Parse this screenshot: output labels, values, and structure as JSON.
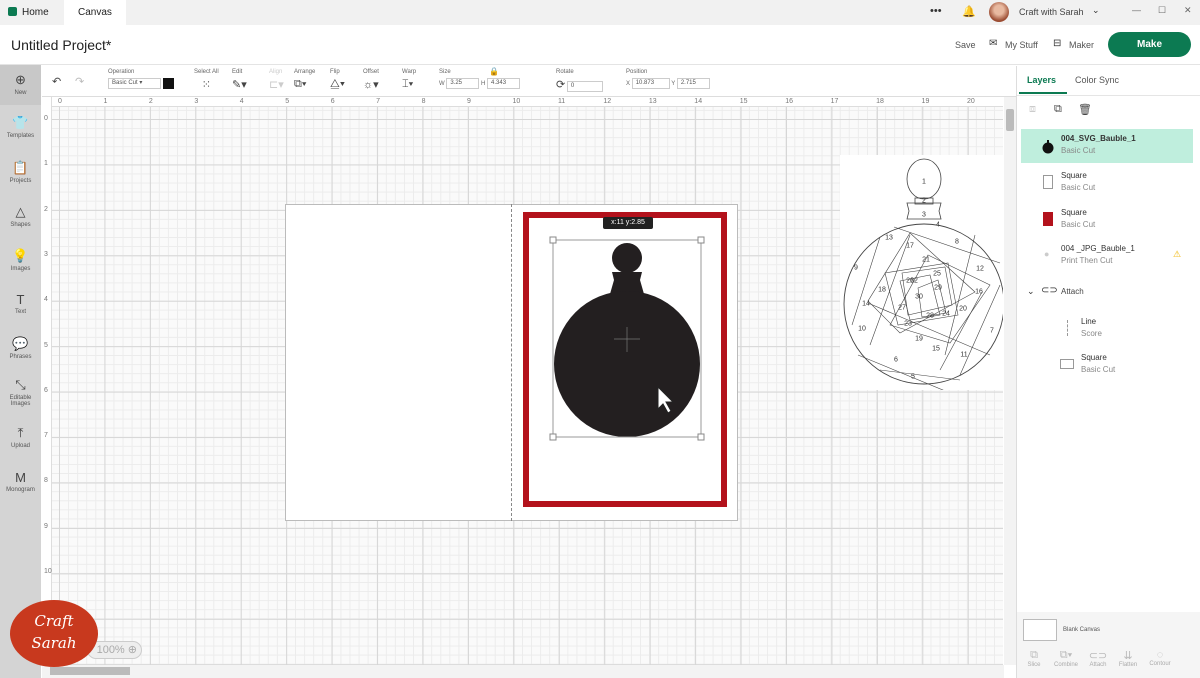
{
  "tabs": [
    {
      "label": "Home"
    },
    {
      "label": "Canvas"
    }
  ],
  "window": {
    "user": "Craft with Sarah",
    "more": "•••",
    "minimize": "—",
    "maximize": "☐",
    "close": "✕"
  },
  "header": {
    "project_title": "Untitled Project*",
    "save": "Save",
    "my_stuff": "My Stuff",
    "maker": "Maker",
    "make": "Make"
  },
  "toolbar": {
    "operation_label": "Operation",
    "operation_value": "Basic Cut",
    "select_all": "Select All",
    "edit": "Edit",
    "align": "Align",
    "arrange": "Arrange",
    "flip": "Flip",
    "offset": "Offset",
    "warp": "Warp",
    "size": "Size",
    "w_label": "W",
    "w_value": "3.25",
    "h_label": "H",
    "h_value": "4.343",
    "rotate": "Rotate",
    "rotate_value": "0",
    "position": "Position",
    "x_label": "X",
    "x_value": "10.873",
    "y_label": "Y",
    "y_value": "2.715",
    "color": "#111111"
  },
  "sidebar": [
    {
      "label": "New",
      "icon": "⊕"
    },
    {
      "label": "Templates",
      "icon": "👕"
    },
    {
      "label": "Projects",
      "icon": "📋"
    },
    {
      "label": "Shapes",
      "icon": "△"
    },
    {
      "label": "Images",
      "icon": "💡"
    },
    {
      "label": "Text",
      "icon": "T"
    },
    {
      "label": "Phrases",
      "icon": "💬"
    },
    {
      "label": "Editable Images",
      "icon": "⤡"
    },
    {
      "label": "Upload",
      "icon": "⤒"
    },
    {
      "label": "Monogram",
      "icon": "M"
    }
  ],
  "ruler": {
    "h": [
      "0",
      "1",
      "2",
      "3",
      "4",
      "5",
      "6",
      "7",
      "8",
      "9",
      "10",
      "11",
      "12",
      "13",
      "14",
      "15",
      "16",
      "17",
      "18",
      "19",
      "20"
    ],
    "v": [
      "0",
      "1",
      "2",
      "3",
      "4",
      "5",
      "6",
      "7",
      "8",
      "9",
      "10"
    ]
  },
  "canvas": {
    "tooltip": "x:11 y:2.85",
    "zoom": "100%",
    "colors": {
      "red": "#b3121c",
      "bauble": "#231f20"
    }
  },
  "pattern_numbers": [
    "1",
    "2",
    "3",
    "4",
    "5",
    "6",
    "7",
    "8",
    "9",
    "10",
    "11",
    "12",
    "13",
    "14",
    "15",
    "16",
    "17",
    "18",
    "19",
    "20",
    "21",
    "22",
    "23",
    "24",
    "25",
    "26",
    "27",
    "28",
    "29",
    "30"
  ],
  "panel": {
    "tabs": [
      "Layers",
      "Color Sync"
    ],
    "layers": [
      {
        "name": "004_SVG_Bauble_1",
        "sub": "Basic Cut"
      },
      {
        "name": "Square",
        "sub": "Basic Cut"
      },
      {
        "name": "Square",
        "sub": "Basic Cut"
      },
      {
        "name": "004 _JPG_Bauble_1",
        "sub": "Print Then Cut"
      }
    ],
    "group": "Attach",
    "group_layers": [
      {
        "name": "Line",
        "sub": "Score"
      },
      {
        "name": "Square",
        "sub": "Basic Cut"
      }
    ],
    "blank_canvas": "Blank Canvas",
    "bottom": [
      "Slice",
      "Combine",
      "Attach",
      "Flatten",
      "Contour"
    ],
    "accent": "#0c7a52",
    "selected_bg": "#bfeedd"
  },
  "watermark": "Craft with Sarah"
}
